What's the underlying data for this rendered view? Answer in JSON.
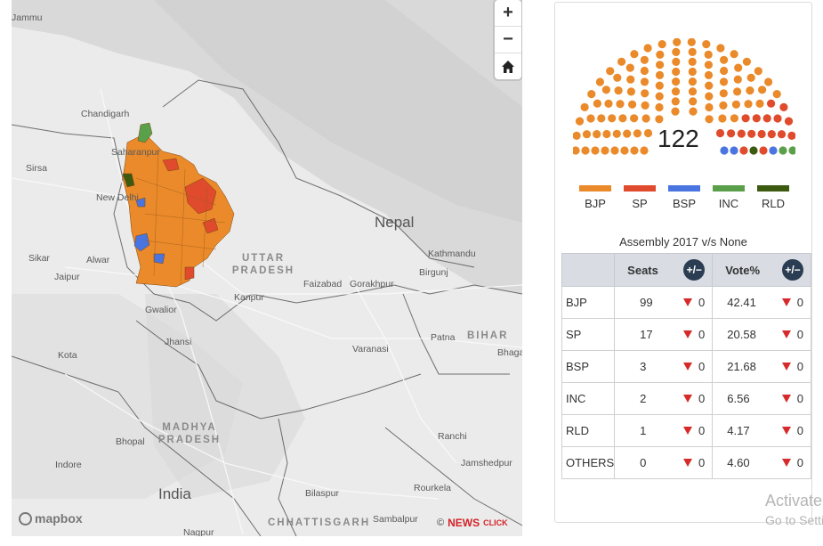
{
  "map": {
    "places": [
      {
        "name": "Jammu",
        "x": 0,
        "y": 0
      },
      {
        "name": "Chandigarh"
      },
      {
        "name": "Sirsa"
      },
      {
        "name": "New Delhi"
      },
      {
        "name": "Sikar"
      },
      {
        "name": "Alwar"
      },
      {
        "name": "Jaipur"
      },
      {
        "name": "Gwalior"
      },
      {
        "name": "Jhansi"
      },
      {
        "name": "Kota"
      },
      {
        "name": "Bhopal"
      },
      {
        "name": "Indore"
      },
      {
        "name": "Nagpur"
      },
      {
        "name": "Kanpur"
      },
      {
        "name": "Faizabad"
      },
      {
        "name": "Gorakhpur"
      },
      {
        "name": "Varanasi"
      },
      {
        "name": "Patna"
      },
      {
        "name": "Kathmandu"
      },
      {
        "name": "Birgunj"
      },
      {
        "name": "Ranchi"
      },
      {
        "name": "Jamshedpur"
      },
      {
        "name": "Rourkela"
      },
      {
        "name": "Bilaspur"
      },
      {
        "name": "Sambalpur"
      },
      {
        "name": "Bhagalpur"
      },
      {
        "name": "Saharanpur"
      }
    ],
    "regions": [
      "UTTAR PRADESH",
      "MADHYA PRADESH",
      "BIHAR",
      "CHHATTISGARH"
    ],
    "countries": [
      "Nepal",
      "India"
    ],
    "zoom_in": "+",
    "zoom_out": "−",
    "home_icon": "home-icon",
    "attribution": "mapbox",
    "credit_prefix": "©",
    "credit_brand": "NEWS",
    "credit_brand2": "CLICK",
    "party_colors": {
      "BJP": "#ea8a2a",
      "SP": "#df4b2c",
      "BSP": "#4a74e0",
      "INC": "#5aa04a",
      "RLD": "#3c5a10"
    }
  },
  "panel": {
    "total_seats": "122",
    "legend": [
      {
        "party": "BJP",
        "color": "#ea8a2a"
      },
      {
        "party": "SP",
        "color": "#df4b2c"
      },
      {
        "party": "BSP",
        "color": "#4a74e0"
      },
      {
        "party": "INC",
        "color": "#5aa04a"
      },
      {
        "party": "RLD",
        "color": "#3c5a10"
      }
    ],
    "caption": "Assembly 2017 v/s None",
    "table": {
      "headers": {
        "seats": "Seats",
        "vote": "Vote%",
        "change": "+/−"
      },
      "rows": [
        {
          "party": "BJP",
          "seats": "99",
          "seat_change": "0",
          "vote": "42.41",
          "vote_change": "0"
        },
        {
          "party": "SP",
          "seats": "17",
          "seat_change": "0",
          "vote": "20.58",
          "vote_change": "0"
        },
        {
          "party": "BSP",
          "seats": "3",
          "seat_change": "0",
          "vote": "21.68",
          "vote_change": "0"
        },
        {
          "party": "INC",
          "seats": "2",
          "seat_change": "0",
          "vote": "6.56",
          "vote_change": "0"
        },
        {
          "party": "RLD",
          "seats": "1",
          "seat_change": "0",
          "vote": "4.17",
          "vote_change": "0"
        },
        {
          "party": "OTHERS",
          "seats": "0",
          "seat_change": "0",
          "vote": "4.60",
          "vote_change": "0"
        }
      ]
    }
  },
  "watermark": {
    "line1": "Activate",
    "line2": "Go to Settings"
  }
}
